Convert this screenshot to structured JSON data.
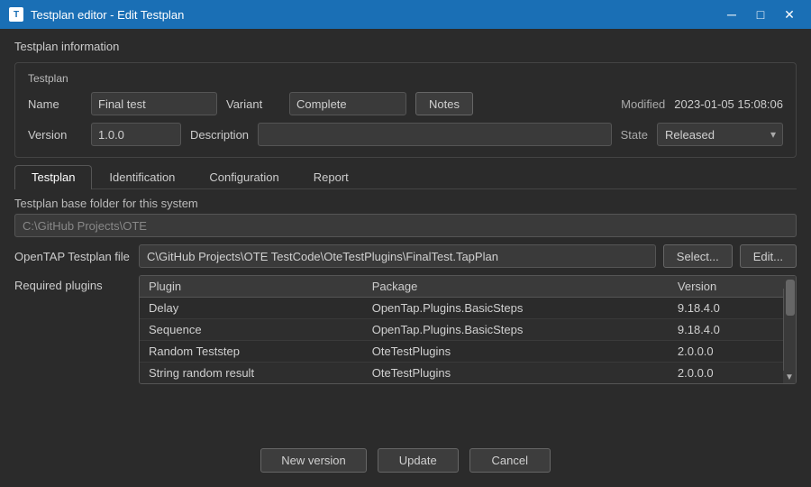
{
  "titlebar": {
    "title": "Testplan editor - Edit Testplan",
    "icon": "T",
    "minimize": "─",
    "maximize": "□",
    "close": "✕"
  },
  "section": {
    "label": "Testplan information",
    "testplan_label": "Testplan",
    "name_label": "Name",
    "name_value": "Final test",
    "variant_label": "Variant",
    "variant_value": "Complete",
    "notes_label": "Notes",
    "modified_label": "Modified",
    "modified_value": "2023-01-05 15:08:06",
    "version_label": "Version",
    "version_value": "1.0.0",
    "description_label": "Description",
    "description_value": "",
    "state_label": "State",
    "state_value": "Released"
  },
  "tabs": {
    "items": [
      {
        "label": "Testplan",
        "active": true
      },
      {
        "label": "Identification",
        "active": false
      },
      {
        "label": "Configuration",
        "active": false
      },
      {
        "label": "Report",
        "active": false
      }
    ]
  },
  "testplan_tab": {
    "base_folder_label": "Testplan base folder for this system",
    "base_folder_value": "C:\\GitHub Projects\\OTE",
    "opentap_label": "OpenTAP Testplan file",
    "opentap_value": "C\\GitHub Projects\\OTE TestCode\\OteTestPlugins\\FinalTest.TapPlan",
    "select_label": "Select...",
    "edit_label": "Edit...",
    "required_plugins_label": "Required plugins",
    "plugins_columns": [
      "Plugin",
      "Package",
      "Version"
    ],
    "plugins_rows": [
      {
        "plugin": "Delay",
        "package": "OpenTap.Plugins.BasicSteps",
        "version": "9.18.4.0"
      },
      {
        "plugin": "Sequence",
        "package": "OpenTap.Plugins.BasicSteps",
        "version": "9.18.4.0"
      },
      {
        "plugin": "Random Teststep",
        "package": "OteTestPlugins",
        "version": "2.0.0.0"
      },
      {
        "plugin": "String random result",
        "package": "OteTestPlugins",
        "version": "2.0.0.0"
      }
    ]
  },
  "bottom": {
    "new_version_label": "New version",
    "update_label": "Update",
    "cancel_label": "Cancel"
  }
}
